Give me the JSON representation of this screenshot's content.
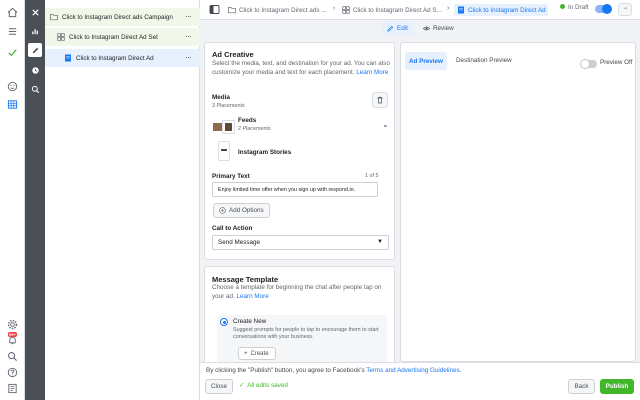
{
  "tree": {
    "campaign": "Click to Instagram Direct ads Campaign",
    "adset": "Click to Instagram Direct Ad Set",
    "ad": "Click to Instagram Direct Ad",
    "more": "···"
  },
  "topbar": {
    "crumb_campaign": "Click to Instagram Direct ads ...",
    "crumb_adset": "Click to Instagram Direct Ad S...",
    "crumb_ad": "Click to Instagram Direct Ad",
    "status": "In Draft",
    "more": "···"
  },
  "tabs": {
    "edit": "Edit",
    "review": "Review"
  },
  "creative": {
    "title": "Ad Creative",
    "desc": "Select the media, text, and destination for your ad. You can also customize your media and text for each placement.",
    "learn_more": "Learn More",
    "media_label": "Media",
    "placements_count": "3 Placements",
    "feeds_label": "Feeds",
    "feeds_count": "2 Placements",
    "stories_label": "Instagram Stories",
    "primary_text_label": "Primary Text",
    "primary_text_count": "1 of 5",
    "primary_text_value": "Enjoy limited time offer when you sign up with respond.io.",
    "add_options": "Add Options",
    "cta_label": "Call to Action",
    "cta_value": "Send Message"
  },
  "template": {
    "title": "Message Template",
    "desc": "Choose a template for beginning the chat after people tap on your ad.",
    "learn_more": "Learn More",
    "option_label": "Create New",
    "option_desc": "Suggest prompts for people to tap to encourage them to start conversations with your business.",
    "create_button": "Create"
  },
  "preview": {
    "tab_ad": "Ad Preview",
    "tab_destination": "Destination Preview",
    "toggle_label": "Preview Off"
  },
  "bottom": {
    "notice_prefix": "By clicking the \"Publish\" button, you agree to Facebook's",
    "notice_link": "Terms and Advertising Guidelines",
    "notice_suffix": ".",
    "close": "Close",
    "saved": "All edits saved",
    "back": "Back",
    "publish": "Publish"
  },
  "nav": {
    "notification_badge": "99+"
  },
  "colors": {
    "accent": "#1877f2",
    "publish": "#42b72a",
    "draft_dot": "#42b72a"
  }
}
